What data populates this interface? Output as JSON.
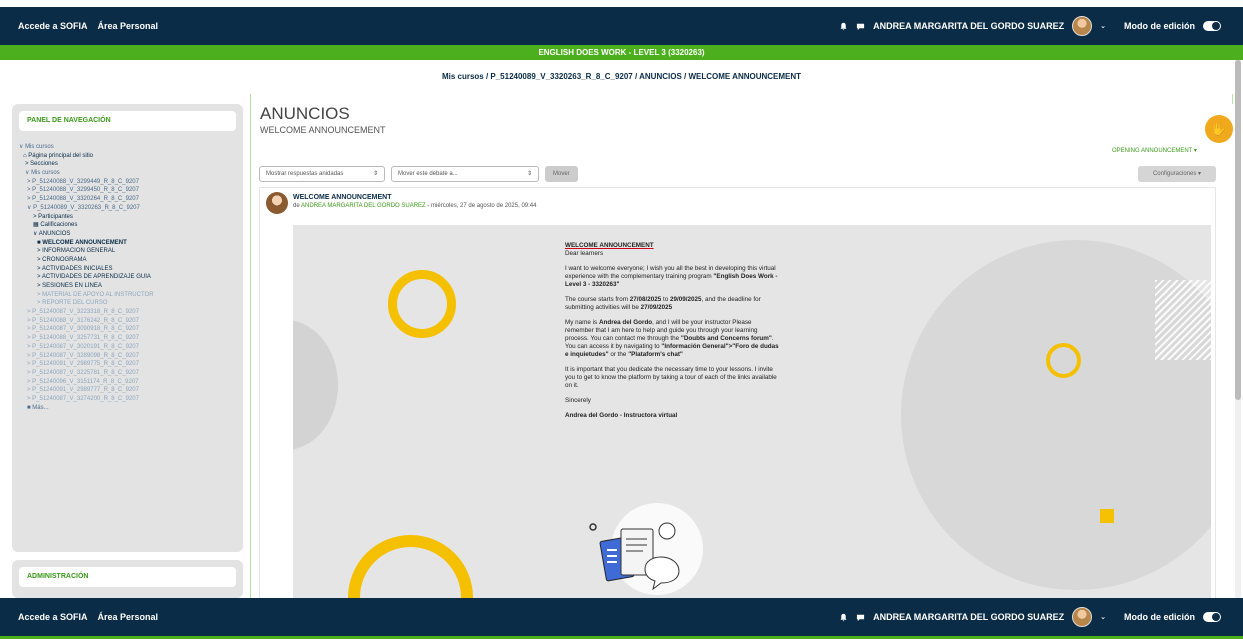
{
  "topbar": {
    "links": [
      "Accede a SOFIA",
      "Área Personal"
    ],
    "user_name": "ANDREA MARGARITA DEL GORDO SUAREZ",
    "edit_mode_label": "Modo de edición",
    "bell_icon": "bell-icon",
    "chat_icon": "chat-icon"
  },
  "course_banner": "ENGLISH DOES WORK - LEVEL 3 (3320263)",
  "breadcrumb": "Mis cursos / P_51240089_V_3320263_R_8_C_9207 / ANUNCIOS / WELCOME ANNOUNCEMENT",
  "sidebar": {
    "title": "PANEL DE NAVEGACIÓN",
    "items": [
      {
        "label": "Mis cursos",
        "style": "normal"
      },
      {
        "label": "Página principal del sitio",
        "style": "dark"
      },
      {
        "label": "Secciones",
        "style": "dark"
      },
      {
        "label": "Mis cursos",
        "style": "normal"
      },
      {
        "label": "P_51240088_V_3299449_R_8_C_9207",
        "style": "normal"
      },
      {
        "label": "P_51240088_V_3299450_R_8_C_9207",
        "style": "normal"
      },
      {
        "label": "P_51240088_V_3320264_R_8_C_9207",
        "style": "normal"
      },
      {
        "label": "P_51240089_V_3320263_R_8_C_9207",
        "style": "normal"
      },
      {
        "label": "Participantes",
        "style": "dark"
      },
      {
        "label": "Calificaciones",
        "style": "dark"
      },
      {
        "label": "ANUNCIOS",
        "style": "dark"
      },
      {
        "label": "WELCOME ANNOUNCEMENT",
        "style": "current"
      },
      {
        "label": "INFORMACIÓN GENERAL",
        "style": "dark"
      },
      {
        "label": "CRONOGRAMA",
        "style": "dark"
      },
      {
        "label": "ACTIVIDADES INICIALES",
        "style": "dark"
      },
      {
        "label": "ACTIVIDADES DE APRENDIZAJE GUÍA",
        "style": "dark"
      },
      {
        "label": "SESIONES EN LÍNEA",
        "style": "dark"
      },
      {
        "label": "MATERIAL DE APOYO AL INSTRUCTOR",
        "style": "faded"
      },
      {
        "label": "REPORTE DEL CURSO",
        "style": "faded"
      },
      {
        "label": "P_51240087_V_3223318_R_8_C_9207",
        "style": "faded"
      },
      {
        "label": "P_51240088_V_3176242_R_8_C_9207",
        "style": "faded"
      },
      {
        "label": "P_51240087_V_3090918_R_8_C_9207",
        "style": "faded"
      },
      {
        "label": "P_51240088_V_3257731_R_8_C_9207",
        "style": "faded"
      },
      {
        "label": "P_51240087_V_3020191_R_8_C_9207",
        "style": "faded"
      },
      {
        "label": "P_51240087_V_3289098_R_8_C_9207",
        "style": "faded"
      },
      {
        "label": "P_51240091_V_2989775_R_8_C_9207",
        "style": "faded"
      },
      {
        "label": "P_51240087_V_3225781_R_8_C_9207",
        "style": "faded"
      },
      {
        "label": "P_51240096_V_3151174_R_8_C_9207",
        "style": "faded"
      },
      {
        "label": "P_51240091_V_2989777_R_8_C_9207",
        "style": "faded"
      },
      {
        "label": "P_51240087_V_3274200_R_8_C_9207",
        "style": "faded"
      },
      {
        "label": "Más...",
        "style": "normal"
      }
    ],
    "admin_title": "ADMINISTRACIÓN"
  },
  "main": {
    "title": "ANUNCIOS",
    "subtitle": "WELCOME ANNOUNCEMENT",
    "opening_link": "OPENING ANNOUNCEMENT",
    "display_mode": "Mostrar respuestas anidadas",
    "move_placeholder": "Mover este debate a...",
    "move_button": "Mover",
    "settings_button": "Configuraciones"
  },
  "post": {
    "subject": "WELCOME ANNOUNCEMENT",
    "by": "de",
    "author": "ANDREA MARGARITA DEL GORDO SUAREZ",
    "date": " - miércoles, 27 de agosto de 2025, 09:44",
    "letter": {
      "heading": "WELCOME ANNOUNCEMENT",
      "greeting": "Dear learners",
      "p1_a": "I want to welcome everyone; I wish you all the best in developing this virtual experience with the complementary training program ",
      "p1_b": "\"English Does Work - Level 3 - 3320263\"",
      "p2_a": "The course starts from ",
      "p2_b": "27/08/2025",
      "p2_c": " to ",
      "p2_d": "29/09/2025",
      "p2_e": ", and the deadline for submitting activities will be ",
      "p2_f": "27/09/2025",
      "p3_a": "My name is ",
      "p3_b": "Andrea del Gordo",
      "p3_c": ", and I will be your instructor Please remember that I am here to help and guide you through your learning process. You can contact me through the ",
      "p3_d": "\"Doubts and Concerns forum\"",
      "p3_e": ". You can access it by navigating to ",
      "p3_f": "\"Información General\">\"Foro de dudas e inquietudes\"",
      "p3_g": " or the ",
      "p3_h": "\"Plataform's chat\"",
      "p4": "It is important that you dedicate the necessary time to your lessons. I invite you to get to know the platform by taking a tour of each of the links available on it.",
      "closing": "Sincerely",
      "signature": "Andrea del Gordo - Instructora virtual"
    }
  },
  "colors": {
    "navy": "#0a2c47",
    "green": "#4caf1e",
    "accent_yellow": "#f5c000",
    "fab_orange": "#f0a81c"
  }
}
